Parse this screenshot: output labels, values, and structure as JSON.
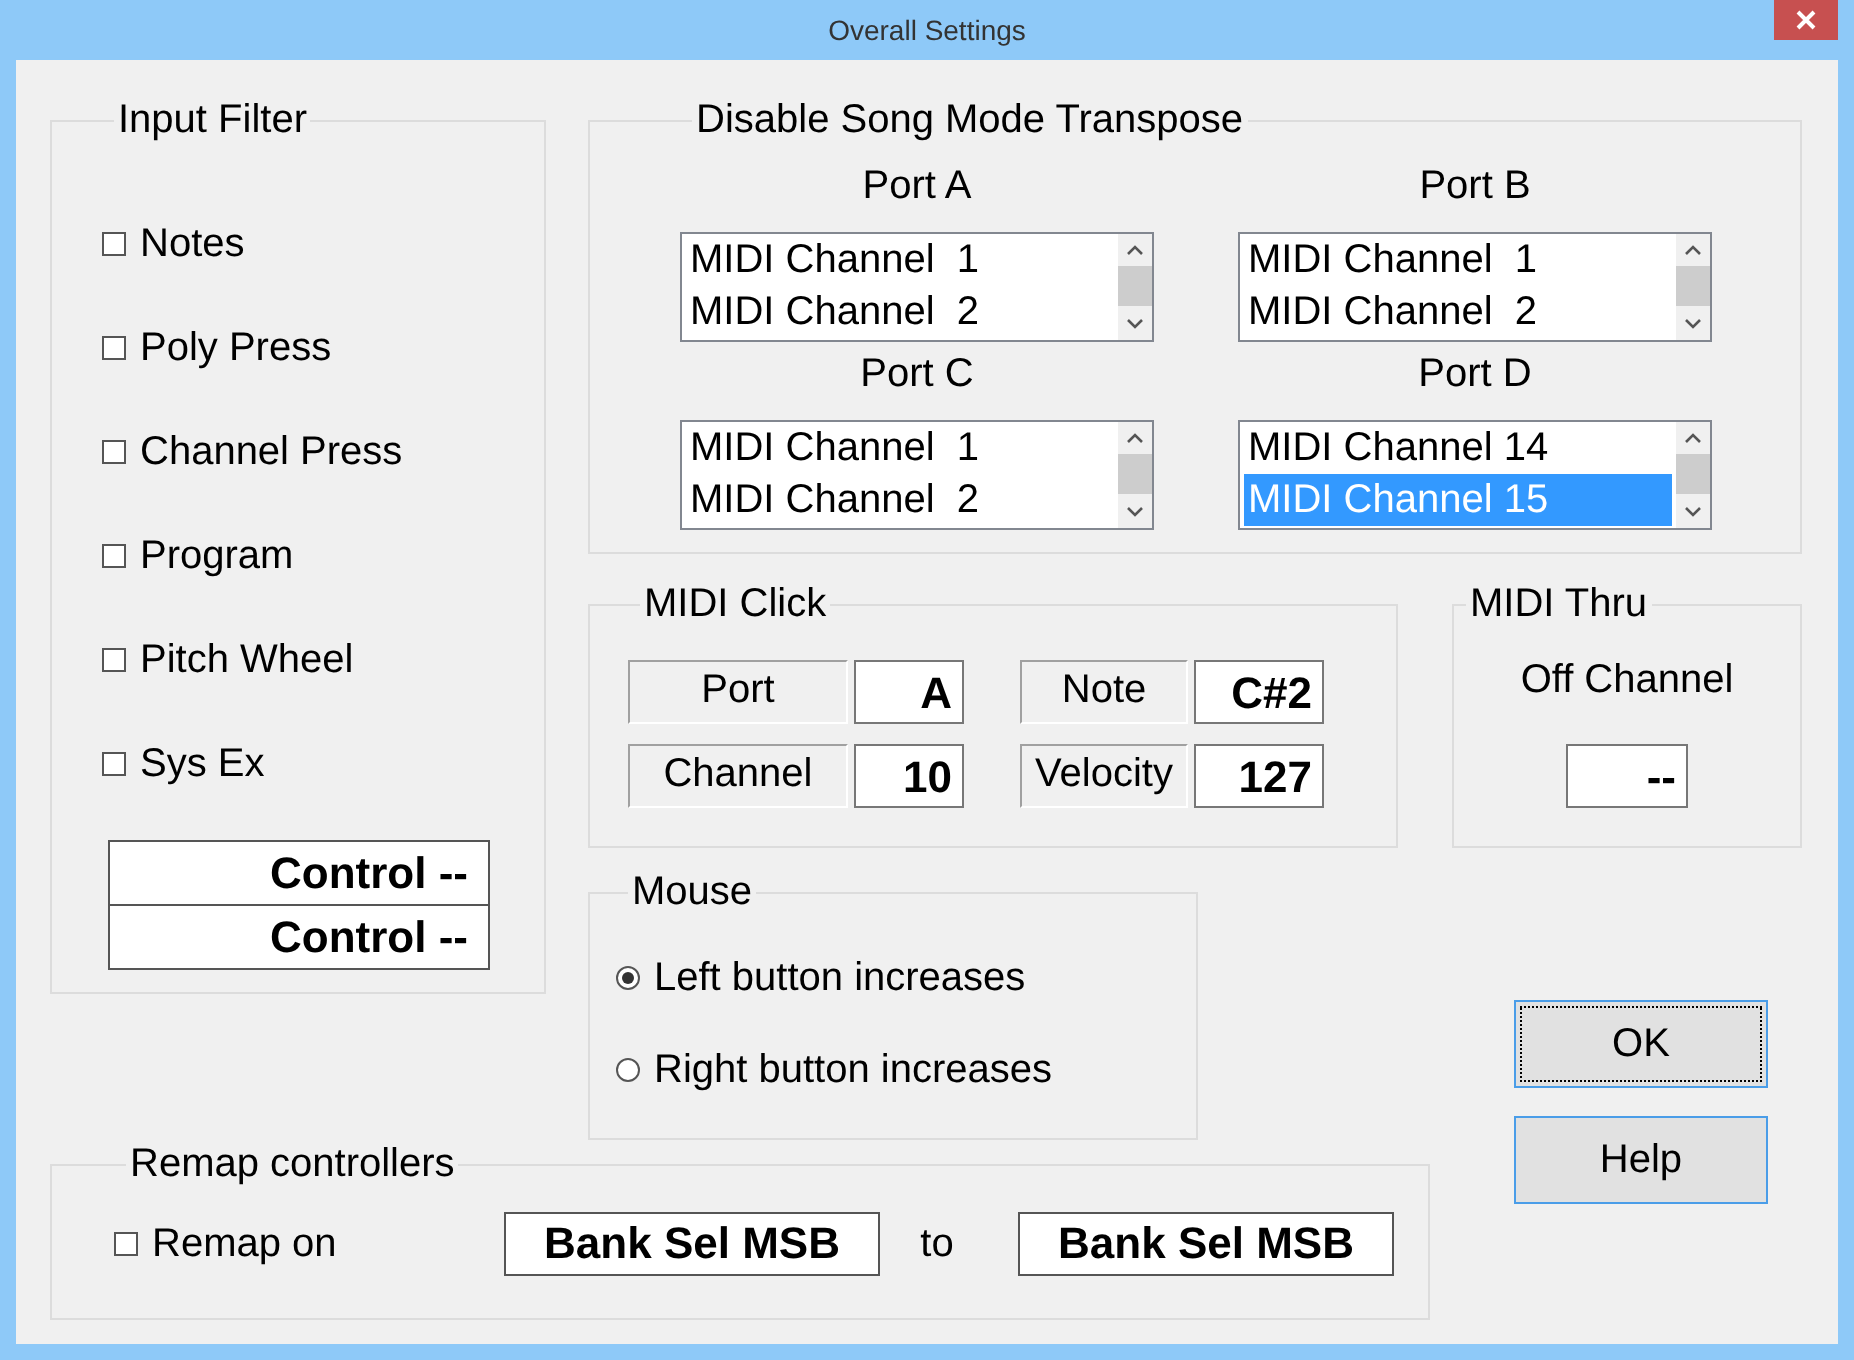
{
  "window": {
    "title": "Overall Settings"
  },
  "input_filter": {
    "title": "Input Filter",
    "items": [
      {
        "label": "Notes",
        "checked": false
      },
      {
        "label": "Poly Press",
        "checked": false
      },
      {
        "label": "Channel Press",
        "checked": false
      },
      {
        "label": "Program",
        "checked": false
      },
      {
        "label": "Pitch Wheel",
        "checked": false
      },
      {
        "label": "Sys Ex",
        "checked": false
      }
    ],
    "controls": [
      "Control --",
      "Control --"
    ]
  },
  "transpose": {
    "title": "Disable Song Mode Transpose",
    "ports": [
      {
        "label": "Port A",
        "items": [
          {
            "text": "MIDI Channel  1",
            "selected": false
          },
          {
            "text": "MIDI Channel  2",
            "selected": false
          }
        ]
      },
      {
        "label": "Port B",
        "items": [
          {
            "text": "MIDI Channel  1",
            "selected": false
          },
          {
            "text": "MIDI Channel  2",
            "selected": false
          }
        ]
      },
      {
        "label": "Port C",
        "items": [
          {
            "text": "MIDI Channel  1",
            "selected": false
          },
          {
            "text": "MIDI Channel  2",
            "selected": false
          }
        ]
      },
      {
        "label": "Port D",
        "items": [
          {
            "text": "MIDI Channel 14",
            "selected": false
          },
          {
            "text": "MIDI Channel 15",
            "selected": true
          }
        ]
      }
    ]
  },
  "midi_click": {
    "title": "MIDI Click",
    "fields": [
      {
        "label": "Port",
        "value": "A"
      },
      {
        "label": "Note",
        "value": "C#2"
      },
      {
        "label": "Channel",
        "value": "10"
      },
      {
        "label": "Velocity",
        "value": "127"
      }
    ]
  },
  "midi_thru": {
    "title": "MIDI Thru",
    "label": "Off Channel",
    "value": "--"
  },
  "mouse": {
    "title": "Mouse",
    "options": [
      {
        "label": "Left button increases",
        "selected": true
      },
      {
        "label": "Right button increases",
        "selected": false
      }
    ]
  },
  "buttons": [
    {
      "label": "OK",
      "focused": true
    },
    {
      "label": "Help",
      "focused": false
    }
  ],
  "remap": {
    "title": "Remap controllers",
    "checkbox": {
      "label": "Remap on",
      "checked": false
    },
    "from": "Bank Sel MSB",
    "connector": "to",
    "to": "Bank Sel MSB"
  }
}
